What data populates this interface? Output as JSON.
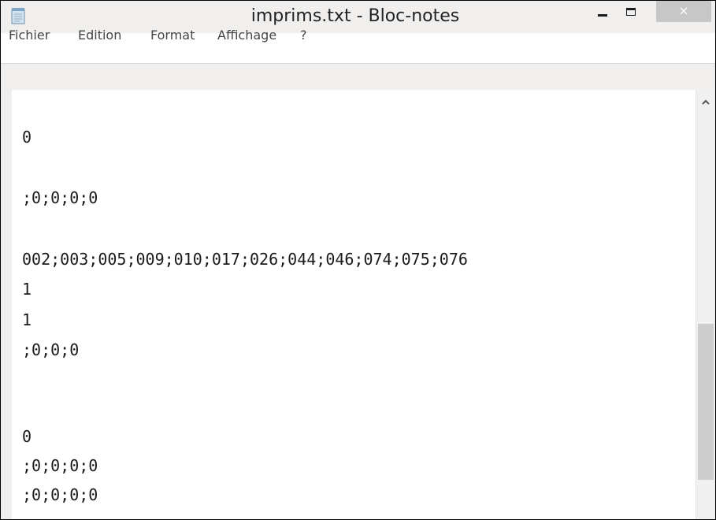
{
  "window": {
    "title": "imprims.txt - Bloc-notes",
    "close_glyph": "×"
  },
  "menu": {
    "items": [
      "Fichier",
      "Edition",
      "Format",
      "Affichage",
      "?"
    ]
  },
  "editor": {
    "lines": [
      "0",
      ";0;0;0;0",
      "002;003;005;009;010;017;026;044;046;074;075;076",
      "1",
      "1",
      ";0;0;0",
      "0",
      ";0;0;0;0",
      ";0;0;0;0"
    ]
  },
  "icons": {
    "app": "notepad-icon",
    "minimize": "minimize-icon",
    "maximize": "maximize-icon",
    "close": "close-icon",
    "scroll_up": "chevron-up-icon"
  }
}
